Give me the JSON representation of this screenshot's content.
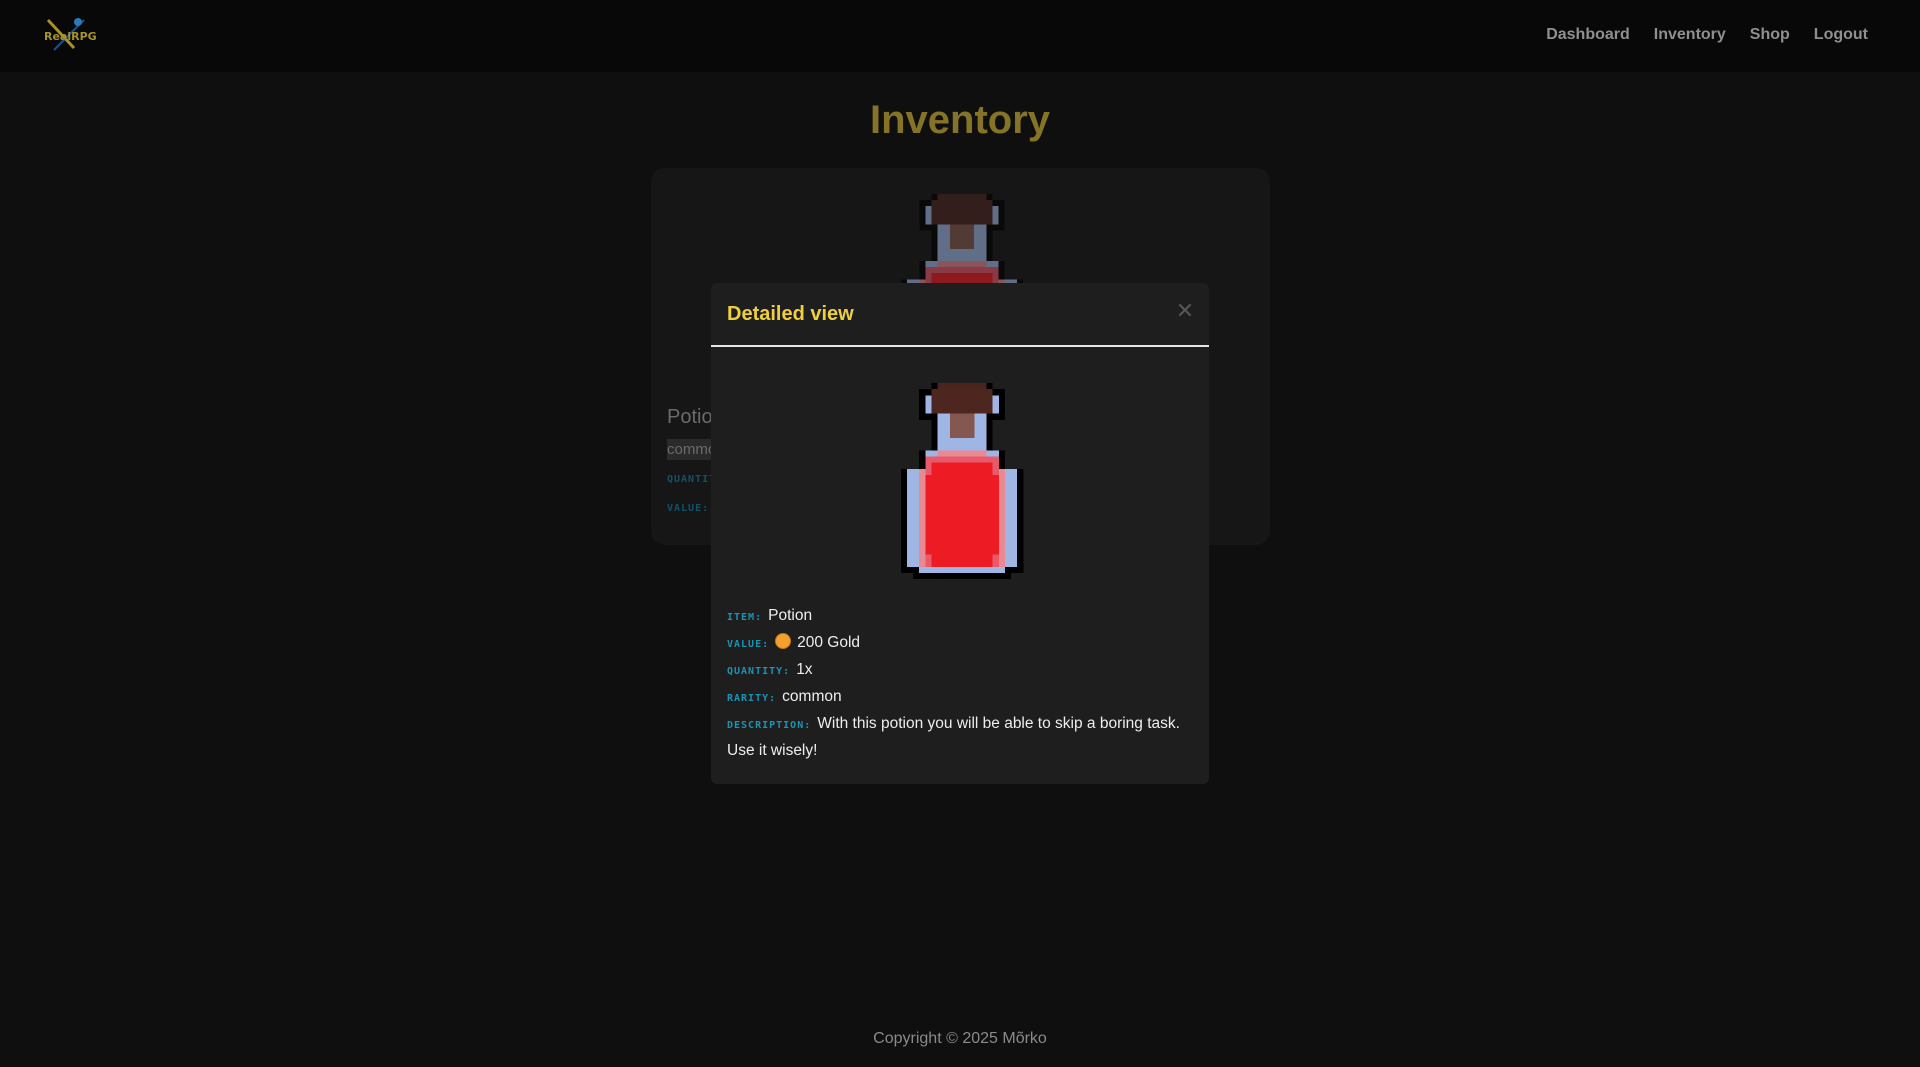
{
  "nav": {
    "logo_text": "RealRPG",
    "links": [
      "Dashboard",
      "Inventory",
      "Shop",
      "Logout"
    ]
  },
  "page_title": "Inventory",
  "card": {
    "name": "Potion",
    "rarity": "common",
    "quantity_label": "QUANTITY:",
    "value_label": "VALUE:"
  },
  "modal": {
    "title": "Detailed view",
    "close_icon": "close-icon",
    "item_label": "ITEM:",
    "item": "Potion",
    "value_label": "VALUE:",
    "value": "200 Gold",
    "quantity_label": "QUANTITY:",
    "quantity": "1x",
    "rarity_label": "RARITY:",
    "rarity": "common",
    "description_label": "DESCRIPTION:",
    "description": "With this potion you will be able to skip a boring task. Use it wisely!"
  },
  "footer": "Copyright © 2025 Mõrko",
  "colors": {
    "accent": "#f0cf3f",
    "label": "#1b93b3"
  }
}
